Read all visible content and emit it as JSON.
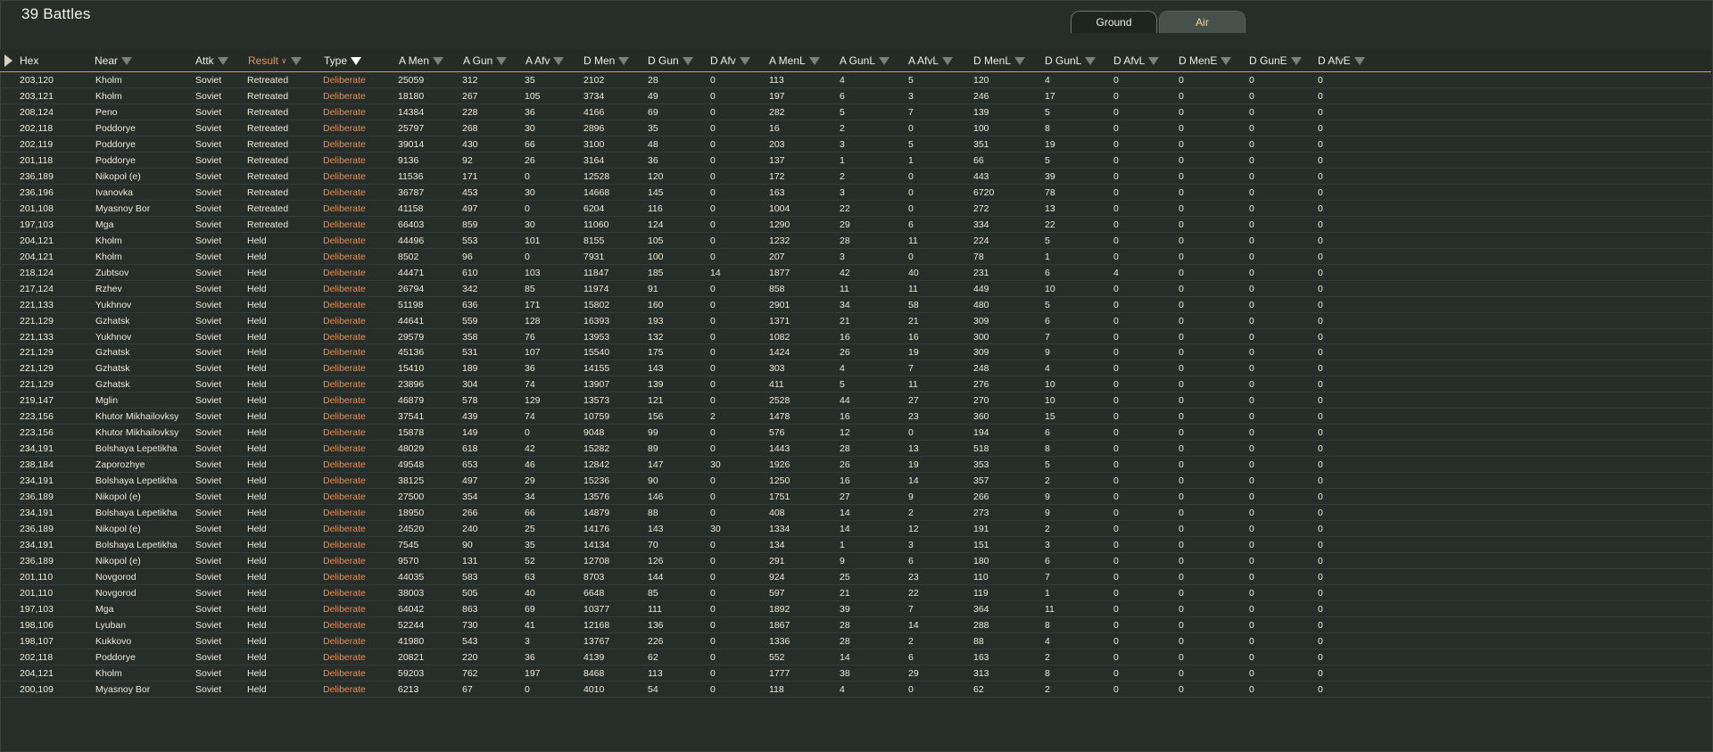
{
  "title": "39 Battles",
  "tabs": [
    {
      "label": "Ground",
      "active": true
    },
    {
      "label": "Air",
      "active": false
    }
  ],
  "columns": [
    "Hex",
    "Near",
    "Attk",
    "Result",
    "Type",
    "A Men",
    "A Gun",
    "A Afv",
    "D Men",
    "D Gun",
    "D Afv",
    "A MenL",
    "A GunL",
    "A AfvL",
    "D MenL",
    "D GunL",
    "D AfvL",
    "D MenE",
    "D GunE",
    "D AfvE"
  ],
  "sorted_column": "Result",
  "active_filter_column": "Type",
  "rows": [
    [
      "203,120",
      "Kholm",
      "Soviet",
      "Retreated",
      "Deliberate",
      "25059",
      "312",
      "35",
      "2102",
      "28",
      "0",
      "113",
      "4",
      "5",
      "120",
      "4",
      "0",
      "0",
      "0",
      "0"
    ],
    [
      "203,121",
      "Kholm",
      "Soviet",
      "Retreated",
      "Deliberate",
      "18180",
      "267",
      "105",
      "3734",
      "49",
      "0",
      "197",
      "6",
      "3",
      "246",
      "17",
      "0",
      "0",
      "0",
      "0"
    ],
    [
      "208,124",
      "Peno",
      "Soviet",
      "Retreated",
      "Deliberate",
      "14384",
      "228",
      "36",
      "4166",
      "69",
      "0",
      "282",
      "5",
      "7",
      "139",
      "5",
      "0",
      "0",
      "0",
      "0"
    ],
    [
      "202,118",
      "Poddorye",
      "Soviet",
      "Retreated",
      "Deliberate",
      "25797",
      "268",
      "30",
      "2896",
      "35",
      "0",
      "16",
      "2",
      "0",
      "100",
      "8",
      "0",
      "0",
      "0",
      "0"
    ],
    [
      "202,119",
      "Poddorye",
      "Soviet",
      "Retreated",
      "Deliberate",
      "39014",
      "430",
      "66",
      "3100",
      "48",
      "0",
      "203",
      "3",
      "5",
      "351",
      "19",
      "0",
      "0",
      "0",
      "0"
    ],
    [
      "201,118",
      "Poddorye",
      "Soviet",
      "Retreated",
      "Deliberate",
      "9136",
      "92",
      "26",
      "3164",
      "36",
      "0",
      "137",
      "1",
      "1",
      "66",
      "5",
      "0",
      "0",
      "0",
      "0"
    ],
    [
      "236,189",
      "Nikopol (e)",
      "Soviet",
      "Retreated",
      "Deliberate",
      "11536",
      "171",
      "0",
      "12528",
      "120",
      "0",
      "172",
      "2",
      "0",
      "443",
      "39",
      "0",
      "0",
      "0",
      "0"
    ],
    [
      "236,196",
      "Ivanovka",
      "Soviet",
      "Retreated",
      "Deliberate",
      "36787",
      "453",
      "30",
      "14668",
      "145",
      "0",
      "163",
      "3",
      "0",
      "6720",
      "78",
      "0",
      "0",
      "0",
      "0"
    ],
    [
      "201,108",
      "Myasnoy Bor",
      "Soviet",
      "Retreated",
      "Deliberate",
      "41158",
      "497",
      "0",
      "6204",
      "116",
      "0",
      "1004",
      "22",
      "0",
      "272",
      "13",
      "0",
      "0",
      "0",
      "0"
    ],
    [
      "197,103",
      "Mga",
      "Soviet",
      "Retreated",
      "Deliberate",
      "66403",
      "859",
      "30",
      "11060",
      "124",
      "0",
      "1290",
      "29",
      "6",
      "334",
      "22",
      "0",
      "0",
      "0",
      "0"
    ],
    [
      "204,121",
      "Kholm",
      "Soviet",
      "Held",
      "Deliberate",
      "44496",
      "553",
      "101",
      "8155",
      "105",
      "0",
      "1232",
      "28",
      "11",
      "224",
      "5",
      "0",
      "0",
      "0",
      "0"
    ],
    [
      "204,121",
      "Kholm",
      "Soviet",
      "Held",
      "Deliberate",
      "8502",
      "96",
      "0",
      "7931",
      "100",
      "0",
      "207",
      "3",
      "0",
      "78",
      "1",
      "0",
      "0",
      "0",
      "0"
    ],
    [
      "218,124",
      "Zubtsov",
      "Soviet",
      "Held",
      "Deliberate",
      "44471",
      "610",
      "103",
      "11847",
      "185",
      "14",
      "1877",
      "42",
      "40",
      "231",
      "6",
      "4",
      "0",
      "0",
      "0"
    ],
    [
      "217,124",
      "Rzhev",
      "Soviet",
      "Held",
      "Deliberate",
      "26794",
      "342",
      "85",
      "11974",
      "91",
      "0",
      "858",
      "11",
      "11",
      "449",
      "10",
      "0",
      "0",
      "0",
      "0"
    ],
    [
      "221,133",
      "Yukhnov",
      "Soviet",
      "Held",
      "Deliberate",
      "51198",
      "636",
      "171",
      "15802",
      "160",
      "0",
      "2901",
      "34",
      "58",
      "480",
      "5",
      "0",
      "0",
      "0",
      "0"
    ],
    [
      "221,129",
      "Gzhatsk",
      "Soviet",
      "Held",
      "Deliberate",
      "44641",
      "559",
      "128",
      "16393",
      "193",
      "0",
      "1371",
      "21",
      "21",
      "309",
      "6",
      "0",
      "0",
      "0",
      "0"
    ],
    [
      "221,133",
      "Yukhnov",
      "Soviet",
      "Held",
      "Deliberate",
      "29579",
      "358",
      "76",
      "13953",
      "132",
      "0",
      "1082",
      "16",
      "16",
      "300",
      "7",
      "0",
      "0",
      "0",
      "0"
    ],
    [
      "221,129",
      "Gzhatsk",
      "Soviet",
      "Held",
      "Deliberate",
      "45136",
      "531",
      "107",
      "15540",
      "175",
      "0",
      "1424",
      "26",
      "19",
      "309",
      "9",
      "0",
      "0",
      "0",
      "0"
    ],
    [
      "221,129",
      "Gzhatsk",
      "Soviet",
      "Held",
      "Deliberate",
      "15410",
      "189",
      "36",
      "14155",
      "143",
      "0",
      "303",
      "4",
      "7",
      "248",
      "4",
      "0",
      "0",
      "0",
      "0"
    ],
    [
      "221,129",
      "Gzhatsk",
      "Soviet",
      "Held",
      "Deliberate",
      "23896",
      "304",
      "74",
      "13907",
      "139",
      "0",
      "411",
      "5",
      "11",
      "276",
      "10",
      "0",
      "0",
      "0",
      "0"
    ],
    [
      "219,147",
      "Mglin",
      "Soviet",
      "Held",
      "Deliberate",
      "46879",
      "578",
      "129",
      "13573",
      "121",
      "0",
      "2528",
      "44",
      "27",
      "270",
      "10",
      "0",
      "0",
      "0",
      "0"
    ],
    [
      "223,156",
      "Khutor Mikhailovksy",
      "Soviet",
      "Held",
      "Deliberate",
      "37541",
      "439",
      "74",
      "10759",
      "156",
      "2",
      "1478",
      "16",
      "23",
      "360",
      "15",
      "0",
      "0",
      "0",
      "0"
    ],
    [
      "223,156",
      "Khutor Mikhailovksy",
      "Soviet",
      "Held",
      "Deliberate",
      "15878",
      "149",
      "0",
      "9048",
      "99",
      "0",
      "576",
      "12",
      "0",
      "194",
      "6",
      "0",
      "0",
      "0",
      "0"
    ],
    [
      "234,191",
      "Bolshaya Lepetikha",
      "Soviet",
      "Held",
      "Deliberate",
      "48029",
      "618",
      "42",
      "15282",
      "89",
      "0",
      "1443",
      "28",
      "13",
      "518",
      "8",
      "0",
      "0",
      "0",
      "0"
    ],
    [
      "238,184",
      "Zaporozhye",
      "Soviet",
      "Held",
      "Deliberate",
      "49548",
      "653",
      "46",
      "12842",
      "147",
      "30",
      "1926",
      "26",
      "19",
      "353",
      "5",
      "0",
      "0",
      "0",
      "0"
    ],
    [
      "234,191",
      "Bolshaya Lepetikha",
      "Soviet",
      "Held",
      "Deliberate",
      "38125",
      "497",
      "29",
      "15236",
      "90",
      "0",
      "1250",
      "16",
      "14",
      "357",
      "2",
      "0",
      "0",
      "0",
      "0"
    ],
    [
      "236,189",
      "Nikopol (e)",
      "Soviet",
      "Held",
      "Deliberate",
      "27500",
      "354",
      "34",
      "13576",
      "146",
      "0",
      "1751",
      "27",
      "9",
      "266",
      "9",
      "0",
      "0",
      "0",
      "0"
    ],
    [
      "234,191",
      "Bolshaya Lepetikha",
      "Soviet",
      "Held",
      "Deliberate",
      "18950",
      "266",
      "66",
      "14879",
      "88",
      "0",
      "408",
      "14",
      "2",
      "273",
      "9",
      "0",
      "0",
      "0",
      "0"
    ],
    [
      "236,189",
      "Nikopol (e)",
      "Soviet",
      "Held",
      "Deliberate",
      "24520",
      "240",
      "25",
      "14176",
      "143",
      "30",
      "1334",
      "14",
      "12",
      "191",
      "2",
      "0",
      "0",
      "0",
      "0"
    ],
    [
      "234,191",
      "Bolshaya Lepetikha",
      "Soviet",
      "Held",
      "Deliberate",
      "7545",
      "90",
      "35",
      "14134",
      "70",
      "0",
      "134",
      "1",
      "3",
      "151",
      "3",
      "0",
      "0",
      "0",
      "0"
    ],
    [
      "236,189",
      "Nikopol (e)",
      "Soviet",
      "Held",
      "Deliberate",
      "9570",
      "131",
      "52",
      "12708",
      "126",
      "0",
      "291",
      "9",
      "6",
      "180",
      "6",
      "0",
      "0",
      "0",
      "0"
    ],
    [
      "201,110",
      "Novgorod",
      "Soviet",
      "Held",
      "Deliberate",
      "44035",
      "583",
      "63",
      "8703",
      "144",
      "0",
      "924",
      "25",
      "23",
      "110",
      "7",
      "0",
      "0",
      "0",
      "0"
    ],
    [
      "201,110",
      "Novgorod",
      "Soviet",
      "Held",
      "Deliberate",
      "38003",
      "505",
      "40",
      "6648",
      "85",
      "0",
      "597",
      "21",
      "22",
      "119",
      "1",
      "0",
      "0",
      "0",
      "0"
    ],
    [
      "197,103",
      "Mga",
      "Soviet",
      "Held",
      "Deliberate",
      "64042",
      "863",
      "69",
      "10377",
      "111",
      "0",
      "1892",
      "39",
      "7",
      "364",
      "11",
      "0",
      "0",
      "0",
      "0"
    ],
    [
      "198,106",
      "Lyuban",
      "Soviet",
      "Held",
      "Deliberate",
      "52244",
      "730",
      "41",
      "12168",
      "136",
      "0",
      "1867",
      "28",
      "14",
      "288",
      "8",
      "0",
      "0",
      "0",
      "0"
    ],
    [
      "198,107",
      "Kukkovo",
      "Soviet",
      "Held",
      "Deliberate",
      "41980",
      "543",
      "3",
      "13767",
      "226",
      "0",
      "1336",
      "28",
      "2",
      "88",
      "4",
      "0",
      "0",
      "0",
      "0"
    ],
    [
      "202,118",
      "Poddorye",
      "Soviet",
      "Held",
      "Deliberate",
      "20821",
      "220",
      "36",
      "4139",
      "62",
      "0",
      "552",
      "14",
      "6",
      "163",
      "2",
      "0",
      "0",
      "0",
      "0"
    ],
    [
      "204,121",
      "Kholm",
      "Soviet",
      "Held",
      "Deliberate",
      "59203",
      "762",
      "197",
      "8468",
      "113",
      "0",
      "1777",
      "38",
      "29",
      "313",
      "8",
      "0",
      "0",
      "0",
      "0"
    ],
    [
      "200,109",
      "Myasnoy Bor",
      "Soviet",
      "Held",
      "Deliberate",
      "6213",
      "67",
      "0",
      "4010",
      "54",
      "0",
      "118",
      "4",
      "0",
      "62",
      "2",
      "0",
      "0",
      "0",
      "0"
    ]
  ],
  "colors": {
    "background": "#262c28",
    "header_underline": "#c5a84e",
    "sorted_header": "#e8935d",
    "type_text": "#e0925a",
    "air_tab_text": "#f3dc8a"
  }
}
